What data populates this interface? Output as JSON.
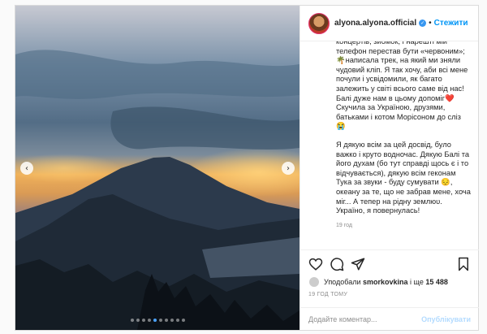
{
  "post": {
    "username": "alyona.alyona.official",
    "follow_label": "Стежити",
    "caption_p1": "концертів, зйомок, і нарешті мій телефон перестав бути «червоним»; 🌴написала трек, на який ми зняли чудовий кліп. Я так хочу, аби всі мене почули і усвідомили, як багато залежить у світі всього саме від нас! Балі дуже нам в цьому допоміг❤️ Скучила за Україною, друзями, батьками і котом Морісоном до сліз 😭",
    "caption_p2": "Я дякую всім за цей досвід, було важко і круто водночас. Дякую Балі та його духам (бо тут справді щось є і то відчувається), дякую всім геконам Тука за звуки - буду сумувати 😔, океану за те, що не забрав мене, хоча міг... А тепер на рідну землюᴜ. Україно, я повернулась!",
    "caption_time": "19 год",
    "likes_prefix": "Уподобали",
    "likes_user": "smorkovkina",
    "likes_middle": "і ще",
    "likes_count": "15 488",
    "date": "19 ГОД ТОМУ",
    "comment_placeholder": "Додайте коментар...",
    "publish_label": "Опублікувати"
  },
  "carousel": {
    "count": 10,
    "active_index": 4
  },
  "icons": [
    "heart-icon",
    "comment-icon",
    "share-icon",
    "bookmark-icon",
    "chevron-left-icon",
    "chevron-right-icon",
    "verified-badge-icon"
  ],
  "colors": {
    "link": "#0095f6",
    "verified": "#3897f0",
    "publish_disabled": "#b3dbff",
    "muted": "#8e8e8e"
  }
}
